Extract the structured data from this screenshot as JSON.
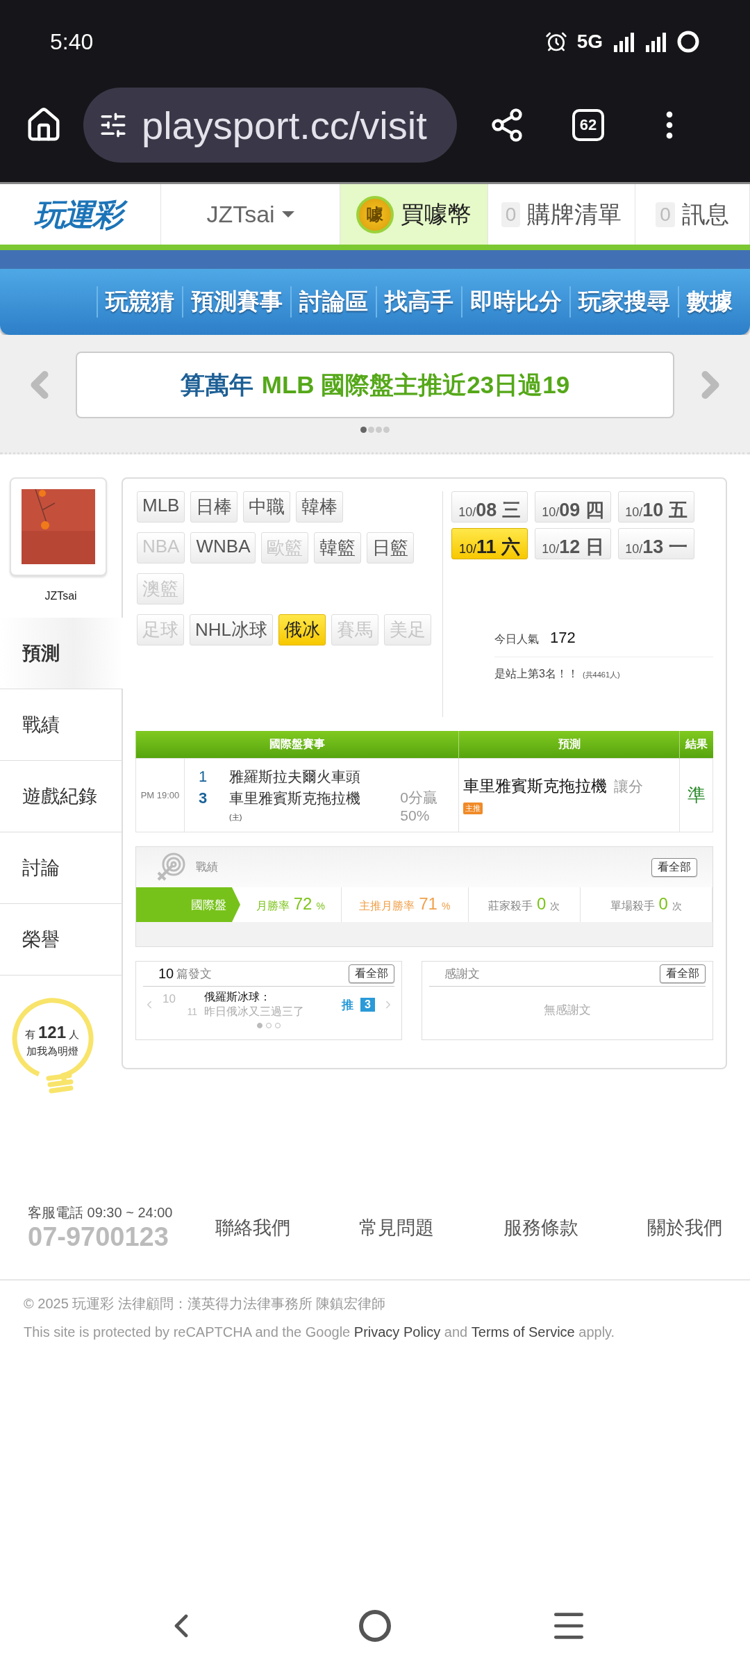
{
  "status_bar": {
    "time": "5:40",
    "network": "5G"
  },
  "browser": {
    "url": "playsport.cc/visit",
    "tab_count": "62"
  },
  "header": {
    "logo": "玩運彩",
    "user": "JZTsai",
    "coin_badge": "噱",
    "coin_button": "買噱幣",
    "cart": {
      "count": "0",
      "label": "購牌清單"
    },
    "messages": {
      "count": "0",
      "label": "訊息"
    }
  },
  "nav": [
    "玩競猜",
    "預測賽事",
    "討論區",
    "找高手",
    "即時比分",
    "玩家搜尋",
    "數據"
  ],
  "banner": {
    "prefix": "算萬年",
    "text": "MLB 國際盤主推近23日過19",
    "dots": [
      {
        "selected": true
      },
      {
        "selected": false
      },
      {
        "selected": false
      },
      {
        "selected": false
      }
    ]
  },
  "profile": {
    "name": "JZTsai"
  },
  "sidebar": [
    {
      "label": "預測",
      "selected": true
    },
    {
      "label": "戰績",
      "selected": false
    },
    {
      "label": "遊戲紀錄",
      "selected": false
    },
    {
      "label": "討論",
      "selected": false
    },
    {
      "label": "榮譽",
      "selected": false
    }
  ],
  "league_rows": [
    {
      "items": [
        {
          "label": "MLB",
          "disabled": false,
          "selected": false
        },
        {
          "label": "日棒",
          "disabled": false,
          "selected": false
        },
        {
          "label": "中職",
          "disabled": false,
          "selected": false
        },
        {
          "label": "韓棒",
          "disabled": false,
          "selected": false
        }
      ]
    },
    {
      "items": [
        {
          "label": "NBA",
          "disabled": true,
          "selected": false
        },
        {
          "label": "WNBA",
          "disabled": false,
          "selected": false
        },
        {
          "label": "歐籃",
          "disabled": true,
          "selected": false
        },
        {
          "label": "韓籃",
          "disabled": false,
          "selected": false
        },
        {
          "label": "日籃",
          "disabled": false,
          "selected": false
        }
      ]
    },
    {
      "items": [
        {
          "label": "澳籃",
          "disabled": true,
          "selected": false
        }
      ]
    },
    {
      "items": [
        {
          "label": "足球",
          "disabled": true,
          "selected": false
        },
        {
          "label": "NHL冰球",
          "disabled": false,
          "selected": false
        },
        {
          "label": "俄冰",
          "disabled": false,
          "selected": true
        },
        {
          "label": "賽馬",
          "disabled": true,
          "selected": false
        },
        {
          "label": "美足",
          "disabled": true,
          "selected": false
        }
      ]
    }
  ],
  "dates": [
    {
      "month": "10/",
      "day": "08",
      "weekday": "三",
      "selected": false
    },
    {
      "month": "10/",
      "day": "09",
      "weekday": "四",
      "selected": false
    },
    {
      "month": "10/",
      "day": "10",
      "weekday": "五",
      "selected": false
    },
    {
      "month": "10/",
      "day": "11",
      "weekday": "六",
      "selected": true
    },
    {
      "month": "10/",
      "day": "12",
      "weekday": "日",
      "selected": false
    },
    {
      "month": "10/",
      "day": "13",
      "weekday": "一",
      "selected": false
    }
  ],
  "popularity": {
    "label": "今日人氣",
    "value": "172",
    "rank": "是站上第3名！！",
    "total": "(共4461人)"
  },
  "predictions_table": {
    "columns": [
      "國際盤賽事",
      "預測",
      "結果"
    ],
    "rows": [
      {
        "time": "PM 19:00",
        "away_score": "1",
        "away_team": "雅羅斯拉夫爾火車頭",
        "home_score": "3",
        "home_team": "車里雅賓斯克拖拉機",
        "home_mark": "(主)",
        "handicap": "0分贏",
        "handicap_pct": "50%",
        "pick": "車里雅賓斯克拖拉機",
        "pick_type": "讓分",
        "badge": "主推",
        "result": "準"
      }
    ]
  },
  "record": {
    "title": "戰績",
    "view_all": "看全部",
    "category": "國際盤",
    "stats": [
      {
        "kind": "rate",
        "label": "月勝率",
        "value": "72",
        "unit": "%",
        "color": "#7cc31a"
      },
      {
        "kind": "rate",
        "label": "主推月勝率",
        "value": "71",
        "unit": "%",
        "color": "#f0a04a"
      },
      {
        "kind": "count",
        "label": "莊家殺手",
        "value": "0",
        "unit": "次",
        "color": "#7cc31a"
      },
      {
        "kind": "count",
        "label": "單場殺手",
        "value": "0",
        "unit": "次",
        "color": "#7cc31a"
      }
    ]
  },
  "posts": {
    "count": "10",
    "label": "篇發文",
    "view_all": "看全部",
    "items": [
      {
        "month": "10",
        "day": "11",
        "title": "俄羅斯冰球：",
        "excerpt": "昨日俄冰又三過三了",
        "push_label": "推",
        "push_count": "3"
      }
    ],
    "dots": [
      {
        "selected": true
      },
      {
        "selected": false
      },
      {
        "selected": false
      }
    ]
  },
  "thanks": {
    "title": "感謝文",
    "view_all": "看全部",
    "empty": "無感謝文"
  },
  "fans": {
    "prefix": "有",
    "count": "121",
    "suffix": "人",
    "label": "加我為明燈"
  },
  "footer": {
    "hotline": "客服電話 09:30 ~ 24:00",
    "phone": "07-9700123",
    "links": [
      "聯絡我們",
      "常見問題",
      "服務條款",
      "關於我們"
    ],
    "copyright": "© 2025 玩運彩 法律顧問：漢英得力法律事務所 陳鎮宏律師",
    "recaptcha": {
      "before": "This site is protected by reCAPTCHA and the Google",
      "privacy": "Privacy Policy",
      "middle": "and",
      "terms": "Terms of Service",
      "after": "apply."
    }
  }
}
